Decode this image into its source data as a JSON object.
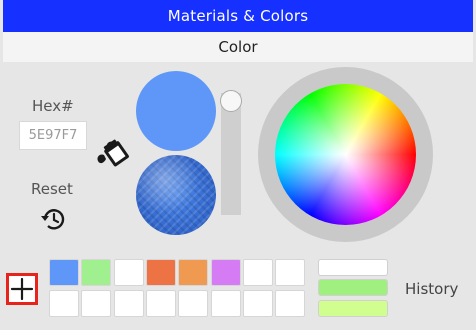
{
  "header": {
    "title": "Materials & Colors"
  },
  "subheader": {
    "title": "Color"
  },
  "left_panel": {
    "hex_label": "Hex#",
    "hex_value": "5E97F7",
    "reset_label": "Reset"
  },
  "preview": {
    "color": "#5e97f7"
  },
  "slider": {
    "level": 1.0
  },
  "palette": {
    "row1": [
      "#5e97f7",
      "#a0f090",
      "#ffffff",
      "#ed7344",
      "#ef9a50",
      "#d57cf5",
      "#ffffff",
      "#ffffff"
    ],
    "row2": [
      "#ffffff",
      "#ffffff",
      "#ffffff",
      "#ffffff",
      "#ffffff",
      "#ffffff",
      "#ffffff",
      "#ffffff"
    ]
  },
  "history": {
    "label": "History",
    "colors": [
      "#ffffff",
      "#a0f080",
      "#d0ff90"
    ]
  },
  "icons": {
    "paint_bucket": "paint-bucket-icon",
    "reset": "history-reset-icon",
    "add": "plus-icon"
  }
}
